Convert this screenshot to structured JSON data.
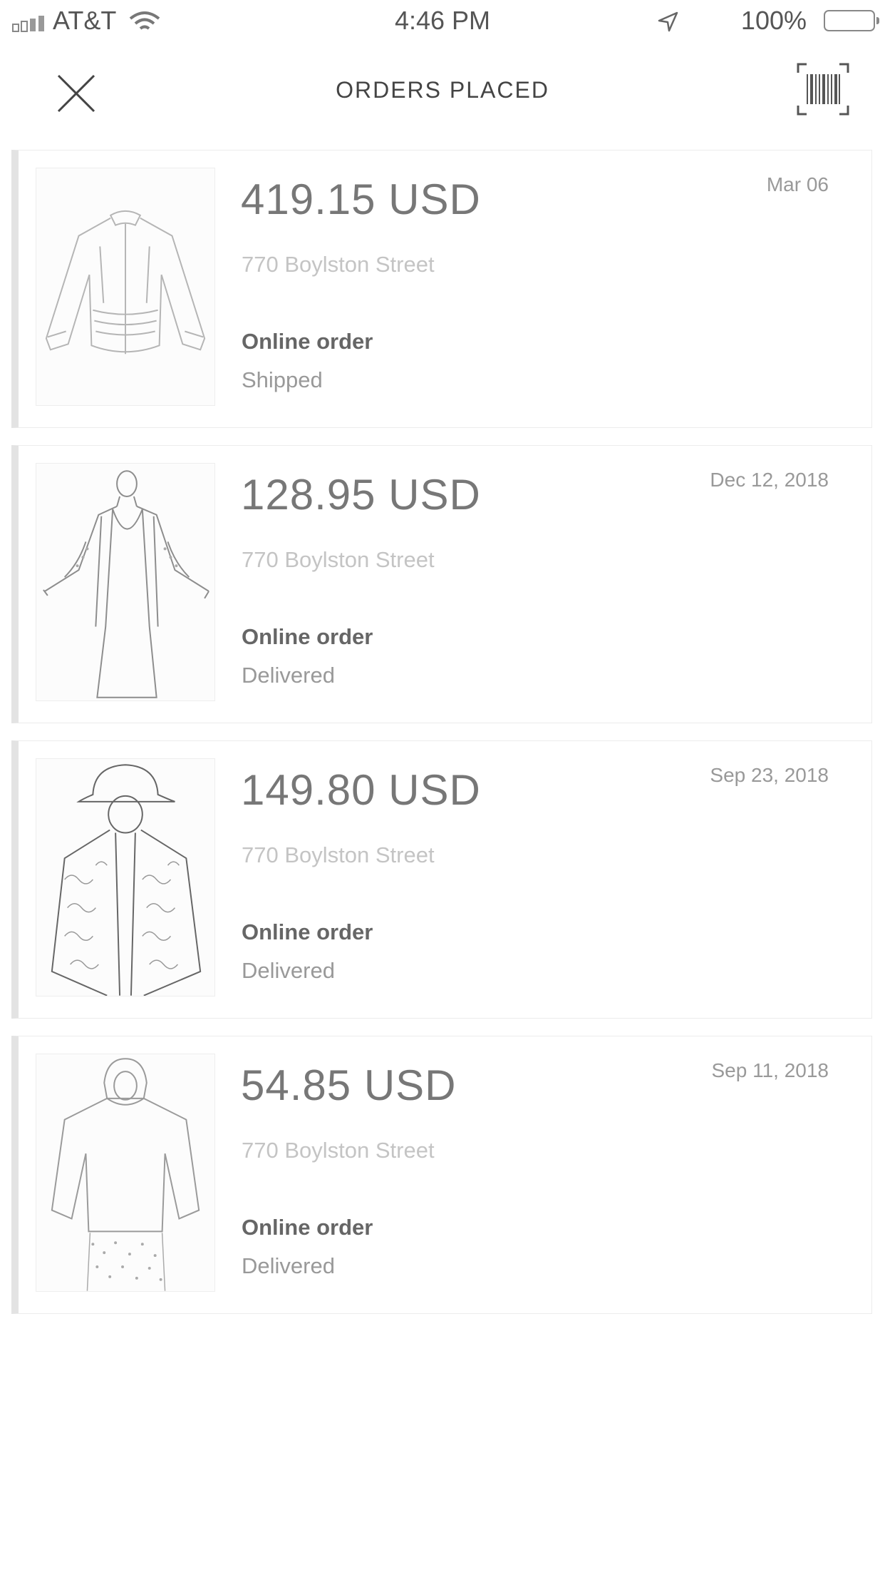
{
  "status_bar": {
    "carrier": "AT&T",
    "time": "4:46 PM",
    "battery": "100%"
  },
  "header": {
    "title": "ORDERS PLACED",
    "close_icon": "close-icon",
    "barcode_icon": "barcode-scan-icon"
  },
  "orders": [
    {
      "price": "419.15 USD",
      "date": "Mar 06",
      "address": "770 Boylston Street",
      "type": "Online order",
      "status": "Shipped"
    },
    {
      "price": "128.95 USD",
      "date": "Dec 12, 2018",
      "address": "770 Boylston Street",
      "type": "Online order",
      "status": "Delivered"
    },
    {
      "price": "149.80 USD",
      "date": "Sep 23, 2018",
      "address": "770 Boylston Street",
      "type": "Online order",
      "status": "Delivered"
    },
    {
      "price": "54.85 USD",
      "date": "Sep 11, 2018",
      "address": "770 Boylston Street",
      "type": "Online order",
      "status": "Delivered"
    }
  ]
}
